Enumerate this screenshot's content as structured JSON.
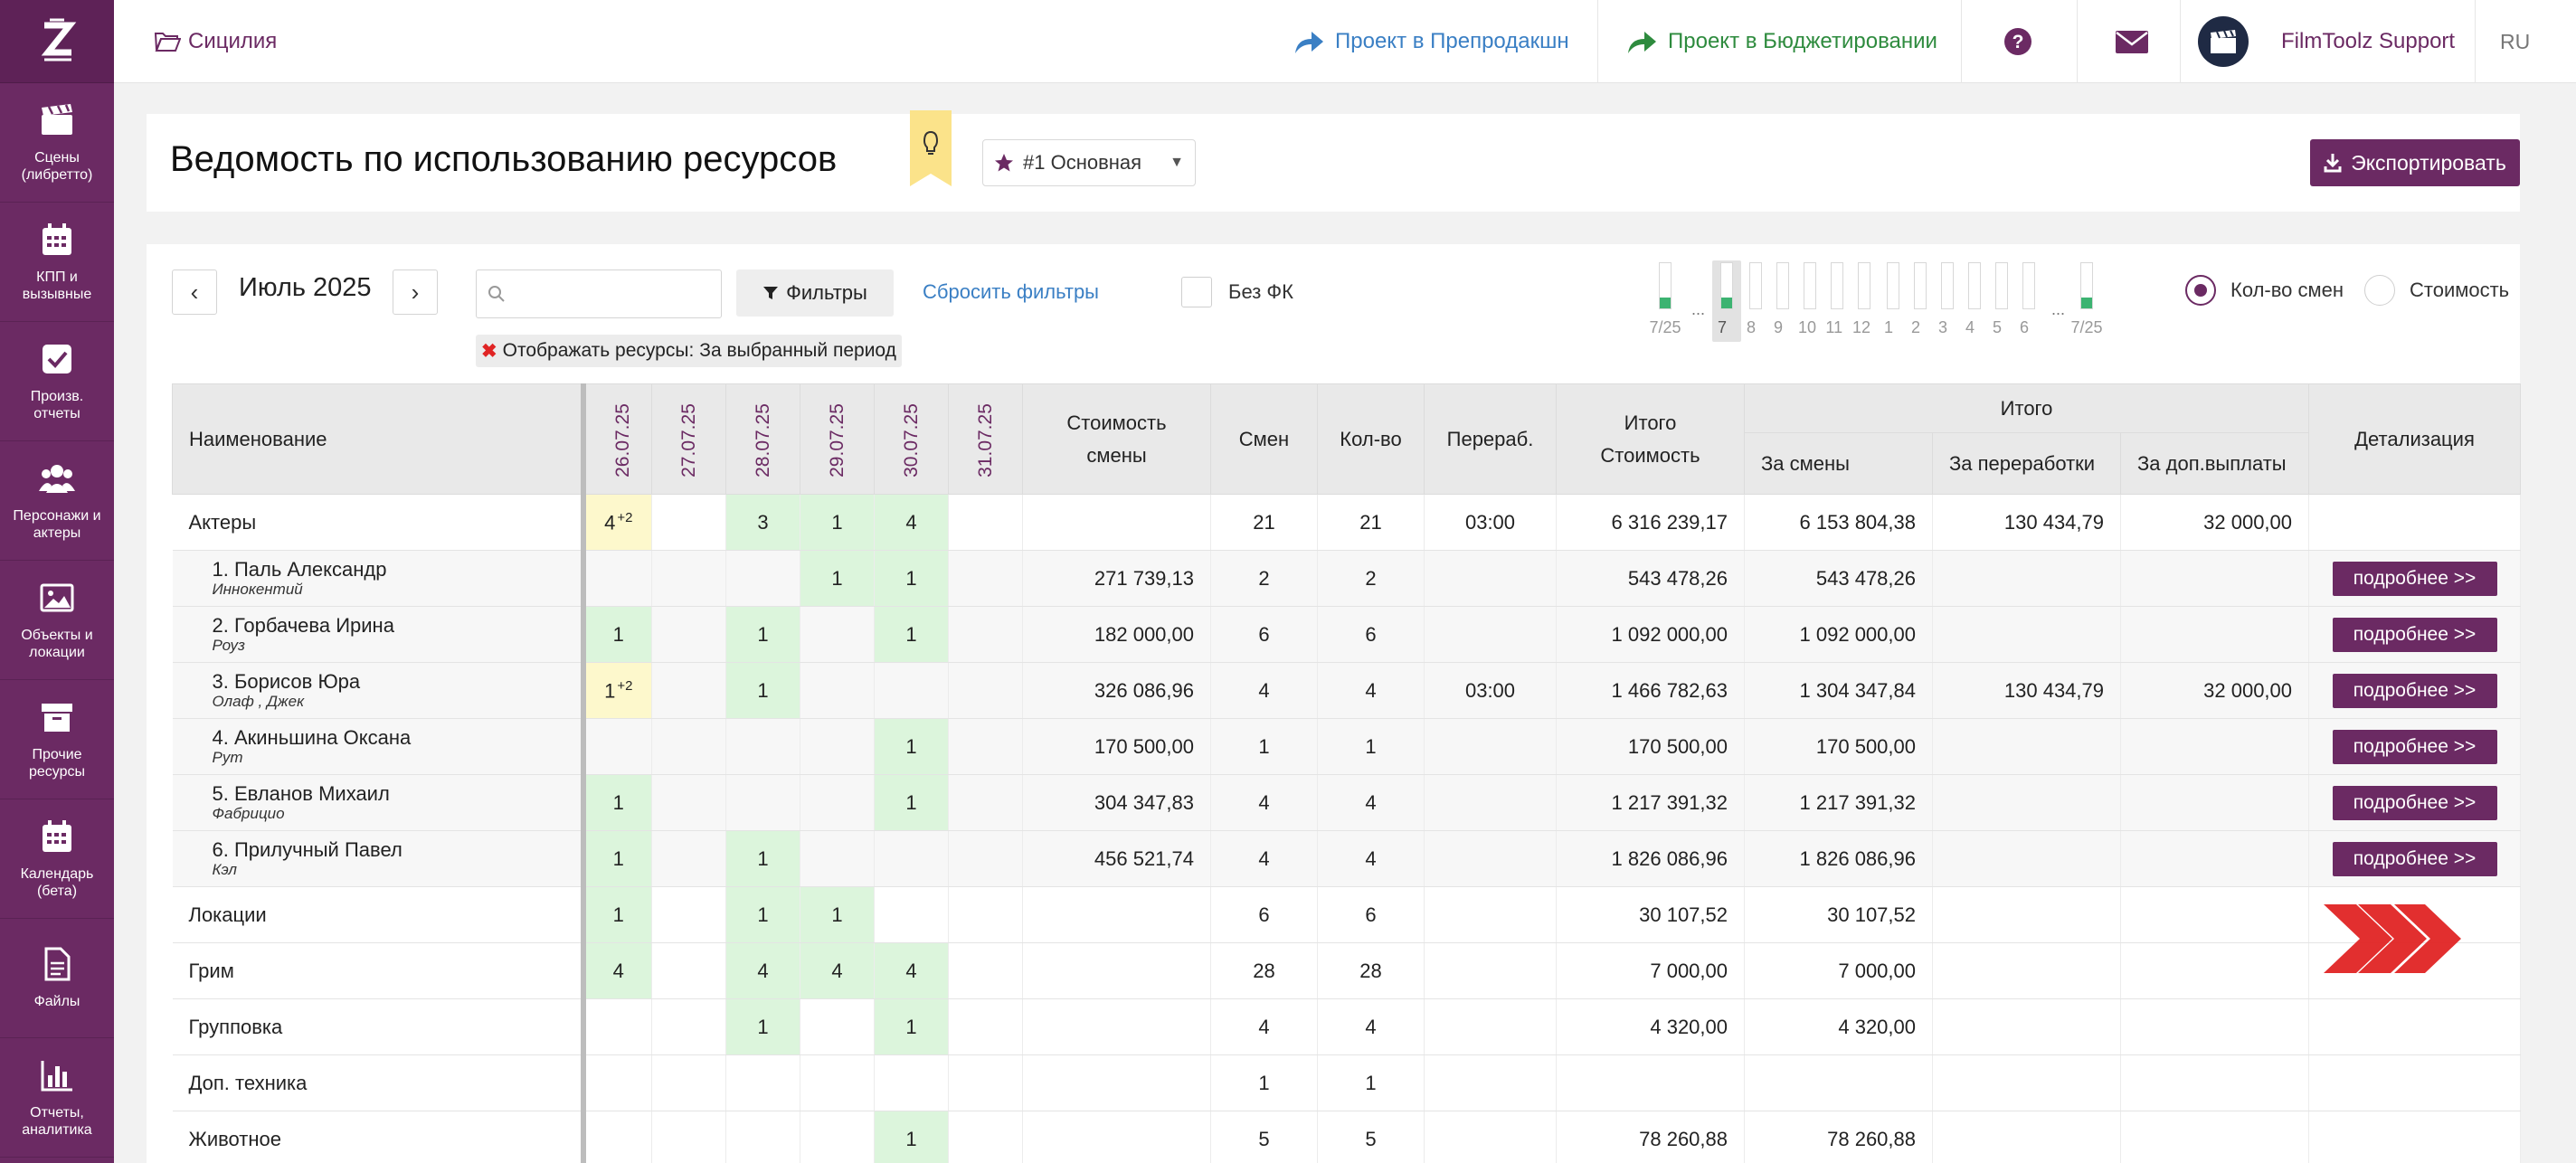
{
  "sidebar": {
    "items": [
      {
        "label": "Сцены (либретто)",
        "icon": "clapperboard-icon"
      },
      {
        "label": "КПП и вызывные",
        "icon": "calendar-icon"
      },
      {
        "label": "Произв. отчеты",
        "icon": "checkbox-icon"
      },
      {
        "label": "Персонажи и актеры",
        "icon": "people-icon"
      },
      {
        "label": "Объекты и локации",
        "icon": "image-icon"
      },
      {
        "label": "Прочие ресурсы",
        "icon": "archive-box-icon"
      },
      {
        "label": "Календарь (бета)",
        "icon": "calendar-icon"
      },
      {
        "label": "Файлы",
        "icon": "file-icon"
      },
      {
        "label": "Отчеты, аналитика",
        "icon": "bar-chart-icon"
      }
    ]
  },
  "topbar": {
    "project": "Сицилия",
    "link_preprod": "Проект в Препродакшн",
    "link_budget": "Проект в Бюджетировании",
    "user": "FilmToolz Support",
    "lang": "RU"
  },
  "header": {
    "title": "Ведомость по использованию ресурсов",
    "version": "#1 Основная",
    "export_label": "Экспортировать"
  },
  "toolbar": {
    "prev": "‹",
    "next": "›",
    "month": "Июль 2025",
    "search_placeholder": "",
    "filters_label": "Фильтры",
    "reset_label": "Сбросить фильтры",
    "no_fk_label": "Без ФК",
    "chip_label": "Отображать ресурсы:",
    "chip_value": "За выбранный период",
    "radio_shifts": "Кол-во смен",
    "radio_cost": "Стоимость"
  },
  "mini_timeline": {
    "bars": [
      {
        "label": "7/25",
        "fill": 0.25
      },
      {
        "label": "7",
        "fill": 0.25,
        "selected": true
      },
      {
        "label": "8",
        "fill": 0
      },
      {
        "label": "9",
        "fill": 0
      },
      {
        "label": "10",
        "fill": 0
      },
      {
        "label": "11",
        "fill": 0
      },
      {
        "label": "12",
        "fill": 0
      },
      {
        "label": "1",
        "fill": 0
      },
      {
        "label": "2",
        "fill": 0
      },
      {
        "label": "3",
        "fill": 0
      },
      {
        "label": "4",
        "fill": 0
      },
      {
        "label": "5",
        "fill": 0
      },
      {
        "label": "6",
        "fill": 0
      },
      {
        "label": "7/25",
        "fill": 0.25
      }
    ],
    "dots": "..."
  },
  "table": {
    "headers": {
      "name": "Наименование",
      "dates": [
        "26.07.25",
        "27.07.25",
        "28.07.25",
        "29.07.25",
        "30.07.25",
        "31.07.25"
      ],
      "shift_cost": "Стоимость смены",
      "shifts": "Смен",
      "qty": "Кол-во",
      "overtime": "Перераб.",
      "total_cost": "Итого Стоимость",
      "itogo": "Итого",
      "for_shifts": "За смены",
      "for_overtime": "За переработки",
      "for_extra": "За доп.выплаты",
      "detail": "Детализация"
    },
    "detail_btn": "подробнее >>",
    "rows": [
      {
        "name": "Актеры",
        "days": [
          "4",
          "",
          "3",
          "1",
          "4",
          ""
        ],
        "sup0": "+2",
        "shift_cost": "",
        "shifts": "21",
        "qty": "21",
        "overtime": "03:00",
        "total": "6 316 239,17",
        "for_shifts": "6 153 804,38",
        "for_overtime": "130 434,79",
        "for_extra": "32 000,00"
      },
      {
        "name": "1. Паль Александр",
        "role": "Иннокентий",
        "days": [
          "",
          "",
          "",
          "1",
          "1",
          ""
        ],
        "shift_cost": "271 739,13",
        "shifts": "2",
        "qty": "2",
        "overtime": "",
        "total": "543 478,26",
        "for_shifts": "543 478,26",
        "for_overtime": "",
        "for_extra": ""
      },
      {
        "name": "2. Горбачева Ирина",
        "role": "Роуз",
        "days": [
          "1",
          "",
          "1",
          "",
          "1",
          ""
        ],
        "shift_cost": "182 000,00",
        "shifts": "6",
        "qty": "6",
        "overtime": "",
        "total": "1 092 000,00",
        "for_shifts": "1 092 000,00",
        "for_overtime": "",
        "for_extra": ""
      },
      {
        "name": "3. Борисов Юра",
        "role": "Олаф , Джек",
        "days": [
          "1",
          "",
          "1",
          "",
          "",
          ""
        ],
        "sup0": "+2",
        "shift_cost": "326 086,96",
        "shifts": "4",
        "qty": "4",
        "overtime": "03:00",
        "total": "1 466 782,63",
        "for_shifts": "1 304 347,84",
        "for_overtime": "130 434,79",
        "for_extra": "32 000,00"
      },
      {
        "name": "4. Акиньшина Оксана",
        "role": "Рут",
        "days": [
          "",
          "",
          "",
          "",
          "1",
          ""
        ],
        "shift_cost": "170 500,00",
        "shifts": "1",
        "qty": "1",
        "overtime": "",
        "total": "170 500,00",
        "for_shifts": "170 500,00",
        "for_overtime": "",
        "for_extra": ""
      },
      {
        "name": "5. Евланов Михаил",
        "role": "Фабрицио",
        "days": [
          "1",
          "",
          "",
          "",
          "1",
          ""
        ],
        "shift_cost": "304 347,83",
        "shifts": "4",
        "qty": "4",
        "overtime": "",
        "total": "1 217 391,32",
        "for_shifts": "1 217 391,32",
        "for_overtime": "",
        "for_extra": ""
      },
      {
        "name": "6. Прилучный Павел",
        "role": "Кэл",
        "days": [
          "1",
          "",
          "1",
          "",
          "",
          ""
        ],
        "shift_cost": "456 521,74",
        "shifts": "4",
        "qty": "4",
        "overtime": "",
        "total": "1 826 086,96",
        "for_shifts": "1 826 086,96",
        "for_overtime": "",
        "for_extra": ""
      },
      {
        "name": "Локации",
        "days": [
          "1",
          "",
          "1",
          "1",
          "",
          ""
        ],
        "shift_cost": "",
        "shifts": "6",
        "qty": "6",
        "overtime": "",
        "total": "30 107,52",
        "for_shifts": "30 107,52",
        "for_overtime": "",
        "for_extra": ""
      },
      {
        "name": "Грим",
        "days": [
          "4",
          "",
          "4",
          "4",
          "4",
          ""
        ],
        "shift_cost": "",
        "shifts": "28",
        "qty": "28",
        "overtime": "",
        "total": "7 000,00",
        "for_shifts": "7 000,00",
        "for_overtime": "",
        "for_extra": ""
      },
      {
        "name": "Групповка",
        "days": [
          "",
          "",
          "1",
          "",
          "1",
          ""
        ],
        "shift_cost": "",
        "shifts": "4",
        "qty": "4",
        "overtime": "",
        "total": "4 320,00",
        "for_shifts": "4 320,00",
        "for_overtime": "",
        "for_extra": ""
      },
      {
        "name": "Доп. техника",
        "days": [
          "",
          "",
          "",
          "",
          "",
          ""
        ],
        "shift_cost": "",
        "shifts": "1",
        "qty": "1",
        "overtime": "",
        "total": "",
        "for_shifts": "",
        "for_overtime": "",
        "for_extra": ""
      },
      {
        "name": "Животное",
        "days": [
          "",
          "",
          "",
          "",
          "1",
          ""
        ],
        "shift_cost": "",
        "shifts": "5",
        "qty": "5",
        "overtime": "",
        "total": "78 260,88",
        "for_shifts": "78 260,88",
        "for_overtime": "",
        "for_extra": ""
      }
    ]
  },
  "colors": {
    "brand": "#6b2a63",
    "link_blue": "#3a7fc4",
    "link_green": "#2e8b3e",
    "cell_green": "#dcf5dc",
    "cell_yellow": "#fdf8cc",
    "arrow_red": "#e02424"
  }
}
